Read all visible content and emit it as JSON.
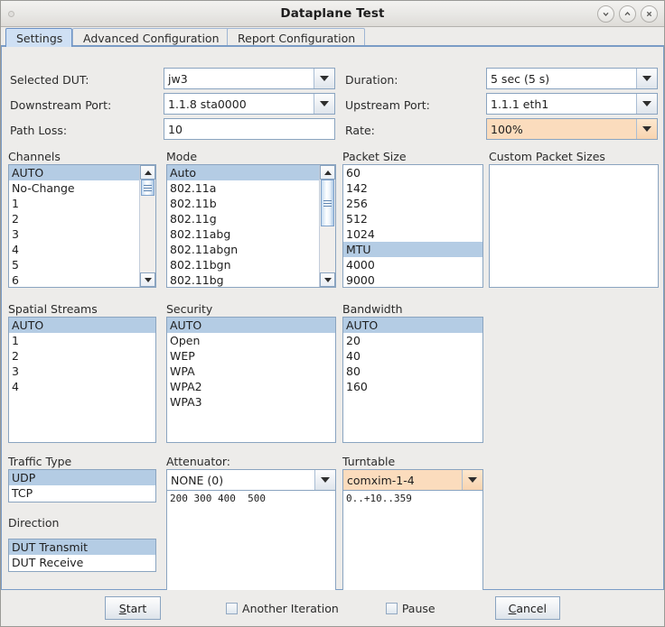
{
  "window": {
    "title": "Dataplane Test",
    "controls": [
      {
        "name": "minimize",
        "glyph": "chevron-down"
      },
      {
        "name": "maximize",
        "glyph": "chevron-up"
      },
      {
        "name": "close",
        "glyph": "x"
      }
    ]
  },
  "tabs": [
    {
      "label": "Settings",
      "active": true
    },
    {
      "label": "Advanced Configuration",
      "active": false
    },
    {
      "label": "Report Configuration",
      "active": false
    }
  ],
  "fields": {
    "selected_dut": {
      "label": "Selected DUT:",
      "value": "jw3"
    },
    "downstream_port": {
      "label": "Downstream Port:",
      "value": "1.1.8 sta0000"
    },
    "path_loss": {
      "label": "Path Loss:",
      "value": "10"
    },
    "duration": {
      "label": "Duration:",
      "value": "5 sec (5 s)"
    },
    "upstream_port": {
      "label": "Upstream Port:",
      "value": "1.1.1 eth1"
    },
    "rate": {
      "label": "Rate:",
      "value": "100%",
      "highlight": "#fbdcbd"
    }
  },
  "lists": {
    "channels": {
      "label": "Channels",
      "items": [
        "AUTO",
        "No-Change",
        "1",
        "2",
        "3",
        "4",
        "5",
        "6"
      ],
      "selected": [
        "AUTO"
      ]
    },
    "mode": {
      "label": "Mode",
      "items": [
        "Auto",
        "802.11a",
        "802.11b",
        "802.11g",
        "802.11abg",
        "802.11abgn",
        "802.11bgn",
        "802.11bg"
      ],
      "selected": [
        "Auto"
      ]
    },
    "packet_size": {
      "label": "Packet Size",
      "items": [
        "60",
        "142",
        "256",
        "512",
        "1024",
        "MTU",
        "4000",
        "9000"
      ],
      "selected": [
        "MTU"
      ]
    },
    "custom_packet_sizes": {
      "label": "Custom Packet Sizes",
      "items": [],
      "selected": []
    },
    "spatial_streams": {
      "label": "Spatial Streams",
      "items": [
        "AUTO",
        "1",
        "2",
        "3",
        "4"
      ],
      "selected": [
        "AUTO"
      ]
    },
    "security": {
      "label": "Security",
      "items": [
        "AUTO",
        "Open",
        "WEP",
        "WPA",
        "WPA2",
        "WPA3"
      ],
      "selected": [
        "AUTO"
      ]
    },
    "bandwidth": {
      "label": "Bandwidth",
      "items": [
        "AUTO",
        "20",
        "40",
        "80",
        "160"
      ],
      "selected": [
        "AUTO"
      ]
    },
    "traffic_type": {
      "label": "Traffic Type",
      "items": [
        "UDP",
        "TCP"
      ],
      "selected": [
        "UDP"
      ]
    },
    "direction": {
      "label": "Direction",
      "items": [
        "DUT Transmit",
        "DUT Receive"
      ],
      "selected": [
        "DUT Transmit"
      ]
    }
  },
  "attenuator": {
    "label": "Attenuator:",
    "value": "NONE (0)",
    "text": "200 300 400  500"
  },
  "turntable": {
    "label": "Turntable",
    "value": "comxim-1-4",
    "highlight": "#fbdcbd",
    "text": "0..+10..359"
  },
  "buttonbar": {
    "start": {
      "pre": "",
      "mnemonic": "S",
      "post": "tart"
    },
    "another_iteration": {
      "label": "Another Iteration",
      "checked": false
    },
    "pause": {
      "label": "Pause",
      "checked": false
    },
    "cancel": {
      "pre": "",
      "mnemonic": "C",
      "post": "ancel"
    }
  },
  "colors": {
    "selection": "#b4cce4",
    "accent": "#7a9cc6",
    "window_bg": "#edecea",
    "highlight": "#fbdcbd"
  }
}
